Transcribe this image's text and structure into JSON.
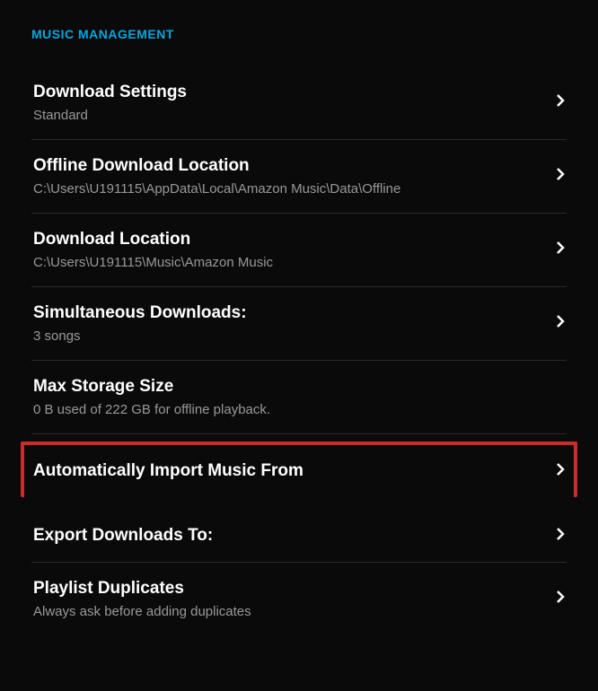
{
  "section_header": "MUSIC MANAGEMENT",
  "items": [
    {
      "title": "Download Settings",
      "subtitle": "Standard",
      "has_chevron": true,
      "highlighted": false
    },
    {
      "title": "Offline Download Location",
      "subtitle": "C:\\Users\\U191115\\AppData\\Local\\Amazon Music\\Data\\Offline",
      "has_chevron": true,
      "highlighted": false
    },
    {
      "title": "Download Location",
      "subtitle": "C:\\Users\\U191115\\Music\\Amazon Music",
      "has_chevron": true,
      "highlighted": false
    },
    {
      "title": "Simultaneous Downloads:",
      "subtitle": "3 songs",
      "has_chevron": true,
      "highlighted": false
    },
    {
      "title": "Max Storage Size",
      "subtitle": "0 B used of 222 GB for offline playback.",
      "has_chevron": false,
      "highlighted": false
    },
    {
      "title": "Automatically Import Music From",
      "subtitle": "",
      "has_chevron": true,
      "highlighted": true
    },
    {
      "title": "Export Downloads To:",
      "subtitle": "",
      "has_chevron": true,
      "highlighted": false
    },
    {
      "title": "Playlist Duplicates",
      "subtitle": "Always ask before adding duplicates",
      "has_chevron": true,
      "highlighted": false
    }
  ]
}
